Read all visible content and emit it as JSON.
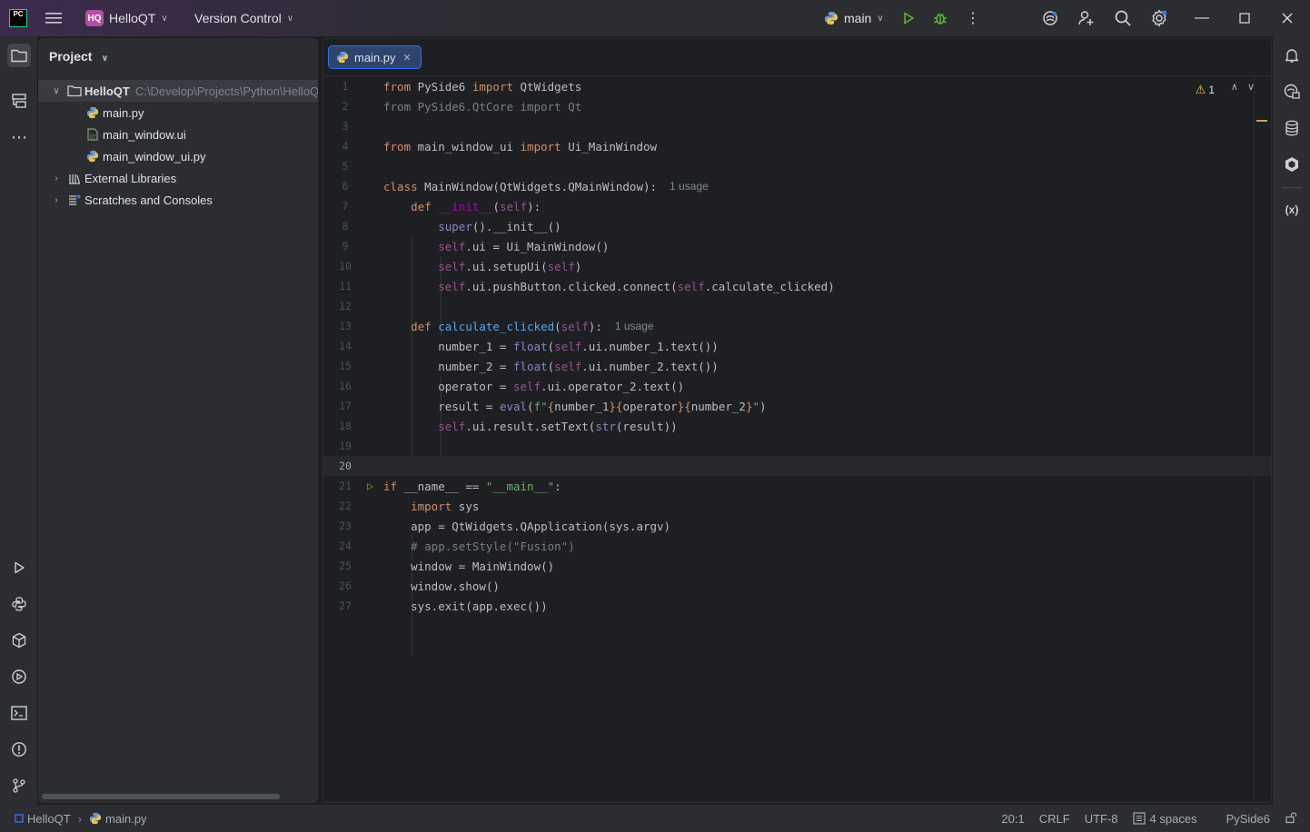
{
  "titlebar": {
    "ide_logo": "PC",
    "project_badge": "HQ",
    "project_name": "HelloQT",
    "vcs_label": "Version Control",
    "run_config": "main"
  },
  "project_panel": {
    "title": "Project",
    "root": {
      "name": "HelloQT",
      "path": "C:\\Develop\\Projects\\Python\\HelloQT"
    },
    "files": [
      "main.py",
      "main_window.ui",
      "main_window_ui.py"
    ],
    "external_libraries": "External Libraries",
    "scratches": "Scratches and Consoles"
  },
  "editor": {
    "tab_label": "main.py",
    "warnings_count": "1",
    "current_line": 20,
    "hints": {
      "usage": "1 usage"
    }
  },
  "statusbar": {
    "breadcrumb_project": "HelloQT",
    "breadcrumb_file": "main.py",
    "position": "20:1",
    "line_ending": "CRLF",
    "encoding": "UTF-8",
    "indent": "4 spaces",
    "interpreter": "PySide6"
  },
  "colors": {
    "accent": "#3574f0",
    "keyword": "#cf8e6d",
    "function": "#56a8f5",
    "string": "#6aab73",
    "self": "#94558d",
    "run_green": "#5fb832"
  }
}
